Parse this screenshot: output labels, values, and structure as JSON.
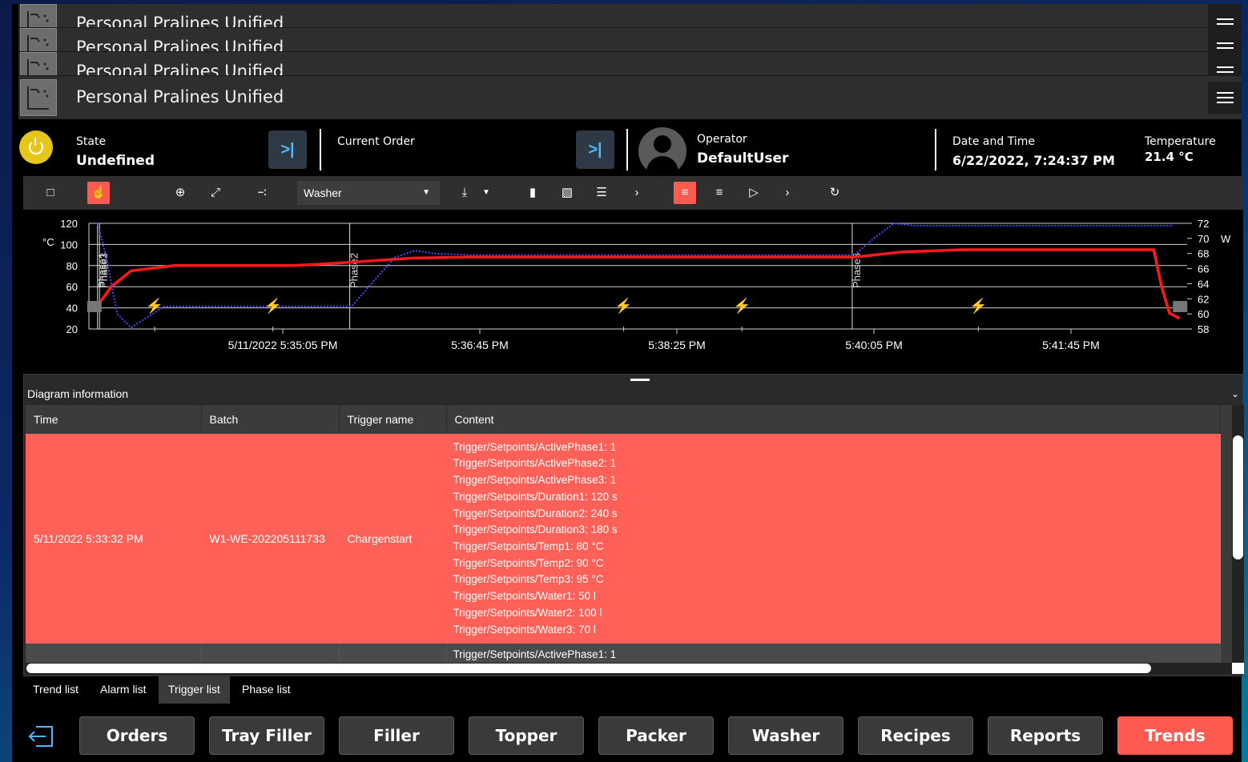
{
  "app": {
    "title": "Personal Pralines Unified"
  },
  "header": {
    "state_label": "State",
    "state_value": "Undefined",
    "order_label": "Current Order",
    "operator_label": "Operator",
    "operator_value": "DefaultUser",
    "datetime_label": "Date and Time",
    "datetime_value": "6/22/2022, 7:24:37 PM",
    "temperature_label": "Temperature",
    "temperature_value": "21.4 °C",
    "power_color": "#e6c619",
    "skip_icon": "skip-next-icon"
  },
  "toolbar": {
    "unit_select": "Washer",
    "accent": "#ff5a4f"
  },
  "chart_data": {
    "type": "line",
    "left_axis": {
      "unit": "°C",
      "ticks": [
        20,
        40,
        60,
        80,
        100,
        120
      ],
      "ylim": [
        20,
        120
      ]
    },
    "right_axis": {
      "unit": "W",
      "ticks": [
        58,
        60,
        62,
        64,
        66,
        68,
        70,
        72
      ],
      "ylim": [
        58,
        72
      ]
    },
    "x_ticks": [
      "5/11/2022 5:35:05 PM",
      "5:36:45 PM",
      "5:38:25 PM",
      "5:40:05 PM",
      "5:41:45 PM"
    ],
    "phase_markers": [
      "Phase1",
      "Phase3",
      "Phase2",
      "Phase3"
    ],
    "series": [
      {
        "color": "#ff1a1a",
        "axis": "left",
        "points": [
          [
            "5:33:31",
            42
          ],
          [
            "5:33:38",
            60
          ],
          [
            "5:33:48",
            75
          ],
          [
            "5:34:10",
            80
          ],
          [
            "5:35:10",
            80
          ],
          [
            "5:35:30",
            82
          ],
          [
            "5:36:10",
            87
          ],
          [
            "5:36:40",
            88
          ],
          [
            "5:39:55",
            88
          ],
          [
            "5:40:20",
            93
          ],
          [
            "5:40:50",
            95
          ],
          [
            "5:42:27",
            95
          ],
          [
            "5:42:31",
            60
          ],
          [
            "5:42:35",
            35
          ],
          [
            "5:42:40",
            30
          ]
        ]
      },
      {
        "color": "#4a4aff",
        "axis": "right",
        "points": [
          [
            "5:33:31",
            72
          ],
          [
            "5:33:35",
            68
          ],
          [
            "5:33:41",
            60
          ],
          [
            "5:33:48",
            58.2
          ],
          [
            "5:34:05",
            61
          ],
          [
            "5:34:30",
            61
          ],
          [
            "5:35:30",
            61
          ],
          [
            "5:35:40",
            61
          ],
          [
            "5:35:50",
            64
          ],
          [
            "5:36:02",
            67.5
          ],
          [
            "5:36:12",
            68.4
          ],
          [
            "5:36:22",
            68
          ],
          [
            "5:36:40",
            67.8
          ],
          [
            "5:39:55",
            67.8
          ],
          [
            "5:40:05",
            70
          ],
          [
            "5:40:15",
            72
          ],
          [
            "5:40:25",
            71.7
          ],
          [
            "5:42:37",
            71.7
          ]
        ]
      }
    ],
    "trigger_times": [
      "5:34:00",
      "5:35:00",
      "5:37:58",
      "5:38:58",
      "5:40:58"
    ]
  },
  "panel": {
    "title": "Diagram information",
    "columns": [
      "Time",
      "Batch",
      "Trigger name",
      "Content"
    ],
    "rows": [
      {
        "time": "5/11/2022 5:33:32 PM",
        "batch": "W1-WE-202205111733",
        "trigger": "Chargenstart",
        "content": [
          "Trigger/Setpoints/ActivePhase1: 1",
          "Trigger/Setpoints/ActivePhase2: 1",
          "Trigger/Setpoints/ActivePhase3: 1",
          "Trigger/Setpoints/Duration1: 120 s",
          "Trigger/Setpoints/Duration2: 240 s",
          "Trigger/Setpoints/Duration3: 180 s",
          "Trigger/Setpoints/Temp1: 80 °C",
          "Trigger/Setpoints/Temp2: 90 °C",
          "Trigger/Setpoints/Temp3: 95 °C",
          "Trigger/Setpoints/Water1: 50 l",
          "Trigger/Setpoints/Water2: 100 l",
          "Trigger/Setpoints/Water3: 70 l"
        ]
      },
      {
        "time": "",
        "batch": "",
        "trigger": "",
        "content": [
          "Trigger/Setpoints/ActivePhase1: 1"
        ]
      }
    ]
  },
  "tabs": [
    "Trend list",
    "Alarm list",
    "Trigger list",
    "Phase list"
  ],
  "nav": {
    "items": [
      "Orders",
      "Tray Filler",
      "Filler",
      "Topper",
      "Packer",
      "Washer",
      "Recipes",
      "Reports",
      "Trends"
    ],
    "active": "Trends"
  }
}
